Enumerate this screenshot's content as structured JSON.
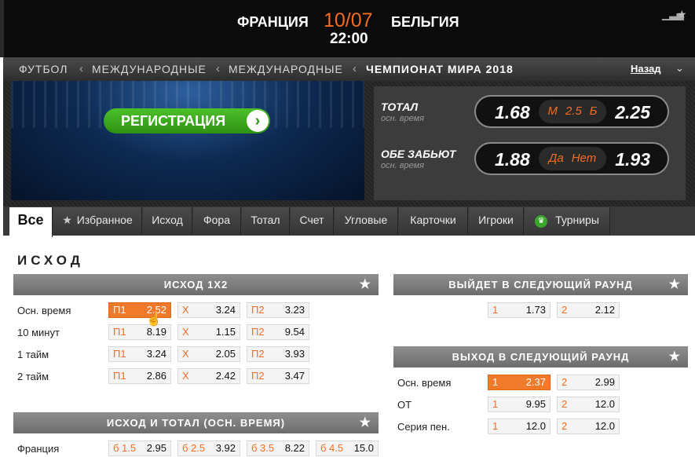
{
  "header": {
    "home_team": "ФРАНЦИЯ",
    "date": "10/07",
    "away_team": "БЕЛЬГИЯ",
    "time": "22:00",
    "stats_icon": "bar-chart-icon",
    "fav_icon": "star-icon"
  },
  "breadcrumb": {
    "items": [
      "ФУТБОЛ",
      "МЕЖДУНАРОДНЫЕ",
      "МЕЖДУНАРОДНЫЕ",
      "ЧЕМПИОНАТ МИРА 2018"
    ],
    "separator": "<",
    "back": "Назад"
  },
  "banner": {
    "button": "РЕГИСТРАЦИЯ"
  },
  "odds_panel": {
    "total": {
      "title": "ТОТАЛ",
      "sub": "осн. время",
      "left": "1.68",
      "mid_a": "М",
      "mid_b": "2.5",
      "mid_c": "Б",
      "right": "2.25"
    },
    "both": {
      "title": "ОБЕ ЗАБЬЮТ",
      "sub": "осн. время",
      "left": "1.88",
      "mid_a": "Да",
      "mid_c": "Нет",
      "right": "1.93"
    }
  },
  "tabs": [
    "Все",
    "Избранное",
    "Исход",
    "Фора",
    "Тотал",
    "Счет",
    "Угловые",
    "Карточки",
    "Игроки",
    "Турниры"
  ],
  "section_title": "ИСХОД",
  "markets": {
    "outcome": {
      "title": "ИСХОД 1X2",
      "rows": [
        {
          "label": "Осн. время",
          "odds": [
            [
              "П1",
              "2.52"
            ],
            [
              "Х",
              "3.24"
            ],
            [
              "П2",
              "3.23"
            ]
          ]
        },
        {
          "label": "10 минут",
          "odds": [
            [
              "П1",
              "8.19"
            ],
            [
              "Х",
              "1.15"
            ],
            [
              "П2",
              "9.54"
            ]
          ]
        },
        {
          "label": "1 тайм",
          "odds": [
            [
              "П1",
              "3.24"
            ],
            [
              "Х",
              "2.05"
            ],
            [
              "П2",
              "3.93"
            ]
          ]
        },
        {
          "label": "2 тайм",
          "odds": [
            [
              "П1",
              "2.86"
            ],
            [
              "Х",
              "2.42"
            ],
            [
              "П2",
              "3.47"
            ]
          ]
        }
      ]
    },
    "next_round": {
      "title": "ВЫЙДЕТ В СЛЕДУЮЩИЙ РАУНД",
      "odds": [
        [
          "1",
          "1.73"
        ],
        [
          "2",
          "2.12"
        ]
      ]
    },
    "advance": {
      "title": "ВЫХОД В СЛЕДУЮЩИЙ РАУНД",
      "rows": [
        {
          "label": "Осн. время",
          "odds": [
            [
              "1",
              "2.37"
            ],
            [
              "2",
              "2.99"
            ]
          ]
        },
        {
          "label": "ОТ",
          "odds": [
            [
              "1",
              "9.95"
            ],
            [
              "2",
              "12.0"
            ]
          ]
        },
        {
          "label": "Серия пен.",
          "odds": [
            [
              "1",
              "12.0"
            ],
            [
              "2",
              "12.0"
            ]
          ]
        }
      ]
    },
    "outcome_total": {
      "title": "ИСХОД И ТОТАЛ (ОСН. ВРЕМЯ)",
      "rows": [
        {
          "label": "Франция",
          "odds": [
            [
              "б 1.5",
              "2.95"
            ],
            [
              "б 2.5",
              "3.92"
            ],
            [
              "б 3.5",
              "8.22"
            ],
            [
              "б 4.5",
              "15.0"
            ]
          ]
        }
      ]
    }
  }
}
